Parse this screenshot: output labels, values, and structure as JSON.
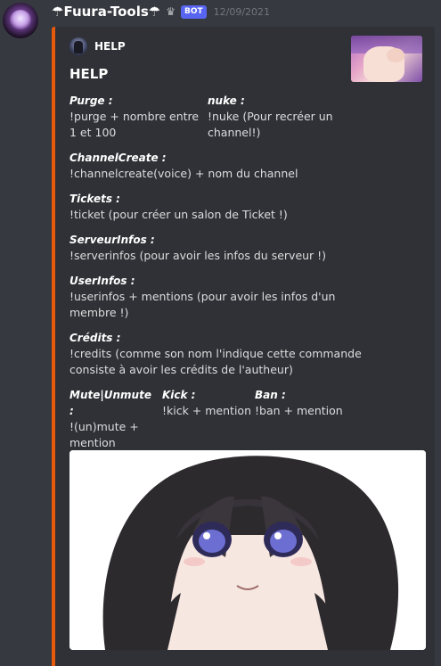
{
  "message": {
    "username": "☂Fuura-Tools☂",
    "bot_tag": "BOT",
    "timestamp": "12/09/2021",
    "avatar_icon": "bot-avatar",
    "crown_icon": "crown-icon"
  },
  "embed": {
    "accent_color": "#e8590c",
    "author": "HELP",
    "title": "HELP",
    "fields": [
      {
        "name": "Purge :",
        "value": "!purge + nombre entre 1 et 100"
      },
      {
        "name": "nuke :",
        "value": "!nuke (Pour recréer un channel!)"
      },
      {
        "name": "ChannelCreate :",
        "value": "!channelcreate(voice) + nom du channel"
      },
      {
        "name": "Tickets :",
        "value": "!ticket (pour créer un salon de Ticket !)"
      },
      {
        "name": "ServeurInfos :",
        "value": "!serverinfos (pour avoir les infos du serveur !)"
      },
      {
        "name": "UserInfos :",
        "value": "!userinfos + mentions (pour avoir les infos d'un membre !)"
      },
      {
        "name": "Crédits :",
        "value": "!credits (comme son nom l'indique cette commande consiste à avoir les crédits de l'autheur)"
      },
      {
        "name": "Mute|Unmute :",
        "value": "!(un)mute + mention"
      },
      {
        "name": "Kick :",
        "value": "!kick + mention"
      },
      {
        "name": "Ban :",
        "value": "!ban + mention"
      }
    ]
  }
}
